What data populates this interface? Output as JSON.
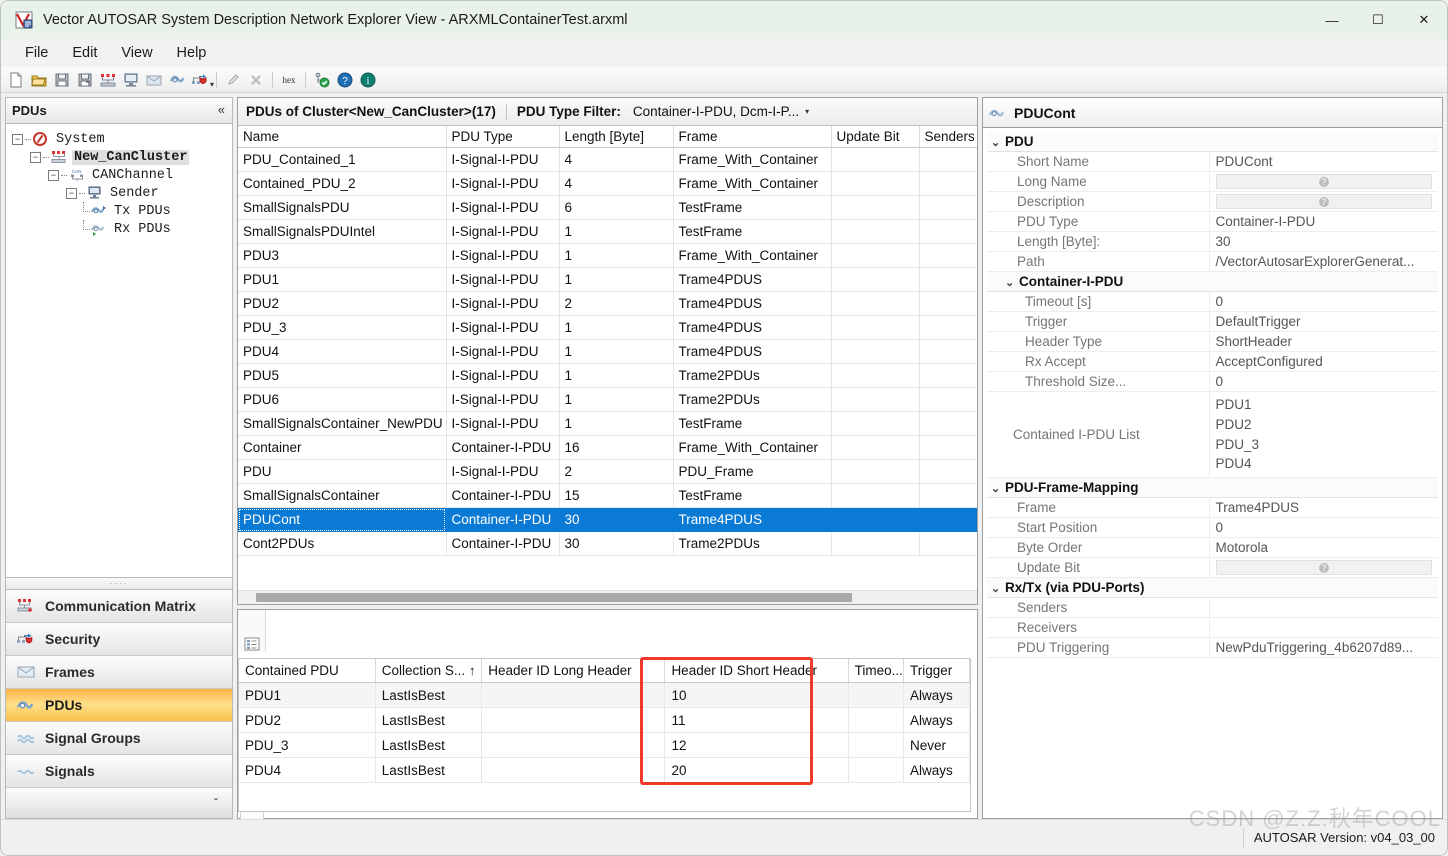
{
  "window": {
    "title": "Vector AUTOSAR System Description Network Explorer View - ARXMLContainerTest.arxml",
    "app_icon": "vector-app-icon",
    "minimize": "—",
    "maximize": "☐",
    "close": "✕"
  },
  "menu": {
    "items": [
      "File",
      "Edit",
      "View",
      "Help"
    ]
  },
  "toolbar": {
    "items": [
      {
        "name": "new-file-icon"
      },
      {
        "name": "open-folder-icon"
      },
      {
        "name": "save-icon"
      },
      {
        "name": "save-as-icon"
      },
      {
        "name": "cluster-icon"
      },
      {
        "name": "ecu-icon"
      },
      {
        "name": "frames-icon"
      },
      {
        "name": "pdus-icon"
      },
      {
        "name": "security-import-icon"
      }
    ],
    "hex_label": "hex",
    "validate_icon": "validate-icon",
    "help_icon": "help-icon",
    "info_icon": "info-icon"
  },
  "explorer": {
    "header": "PDUs",
    "collapse_glyph": "«",
    "tree": [
      {
        "label": "System",
        "icon": "system-icon",
        "depth": 0,
        "expander": "-",
        "selected": false,
        "leaf": false
      },
      {
        "label": "New_CanCluster",
        "icon": "cancluster-icon",
        "depth": 1,
        "expander": "-",
        "selected": true,
        "leaf": false
      },
      {
        "label": "CANChannel",
        "icon": "canchannel-icon",
        "depth": 2,
        "expander": "-",
        "selected": false,
        "leaf": false
      },
      {
        "label": "Sender",
        "icon": "ecu-node-icon",
        "depth": 3,
        "expander": "-",
        "selected": false,
        "leaf": false
      },
      {
        "label": "Tx PDUs",
        "icon": "tx-pdus-icon",
        "depth": 4,
        "expander": "",
        "selected": false,
        "leaf": true
      },
      {
        "label": "Rx PDUs",
        "icon": "rx-pdus-icon",
        "depth": 4,
        "expander": "",
        "selected": false,
        "leaf": true
      }
    ],
    "nav": [
      {
        "label": "Communication Matrix",
        "icon": "comm-matrix-icon",
        "active": false
      },
      {
        "label": "Security",
        "icon": "security-icon",
        "active": false
      },
      {
        "label": "Frames",
        "icon": "frames-envelope-icon",
        "active": false
      },
      {
        "label": "PDUs",
        "icon": "pdus-icon",
        "active": true
      },
      {
        "label": "Signal Groups",
        "icon": "signal-groups-icon",
        "active": false
      },
      {
        "label": "Signals",
        "icon": "signals-icon",
        "active": false
      }
    ],
    "nav_more_glyph": "ˇ"
  },
  "pdu_grid": {
    "title": "PDUs of Cluster<New_CanCluster>(17)",
    "filter_label": "PDU Type Filter:",
    "filter_value": "Container-I-PDU, Dcm-I-P...",
    "filter_caret": "▾",
    "columns": [
      "Name",
      "PDU Type",
      "Length [Byte]",
      "Frame",
      "Update Bit",
      "Senders"
    ],
    "rows": [
      {
        "name": "PDU_Contained_1",
        "type": "I-Signal-I-PDU",
        "length": "4",
        "frame": "Frame_With_Container",
        "update_bit": "",
        "senders": "",
        "selected": false
      },
      {
        "name": "Contained_PDU_2",
        "type": "I-Signal-I-PDU",
        "length": "4",
        "frame": "Frame_With_Container",
        "update_bit": "",
        "senders": "",
        "selected": false
      },
      {
        "name": "SmallSignalsPDU",
        "type": "I-Signal-I-PDU",
        "length": "6",
        "frame": "TestFrame",
        "update_bit": "",
        "senders": "",
        "selected": false
      },
      {
        "name": "SmallSignalsPDUIntel",
        "type": "I-Signal-I-PDU",
        "length": "1",
        "frame": "TestFrame",
        "update_bit": "",
        "senders": "",
        "selected": false
      },
      {
        "name": "PDU3",
        "type": "I-Signal-I-PDU",
        "length": "1",
        "frame": "Frame_With_Container",
        "update_bit": "",
        "senders": "",
        "selected": false
      },
      {
        "name": "PDU1",
        "type": "I-Signal-I-PDU",
        "length": "1",
        "frame": "Trame4PDUS",
        "update_bit": "",
        "senders": "",
        "selected": false
      },
      {
        "name": "PDU2",
        "type": "I-Signal-I-PDU",
        "length": "2",
        "frame": "Trame4PDUS",
        "update_bit": "",
        "senders": "",
        "selected": false
      },
      {
        "name": "PDU_3",
        "type": "I-Signal-I-PDU",
        "length": "1",
        "frame": "Trame4PDUS",
        "update_bit": "",
        "senders": "",
        "selected": false
      },
      {
        "name": "PDU4",
        "type": "I-Signal-I-PDU",
        "length": "1",
        "frame": "Trame4PDUS",
        "update_bit": "",
        "senders": "",
        "selected": false
      },
      {
        "name": "PDU5",
        "type": "I-Signal-I-PDU",
        "length": "1",
        "frame": "Trame2PDUs",
        "update_bit": "",
        "senders": "",
        "selected": false
      },
      {
        "name": "PDU6",
        "type": "I-Signal-I-PDU",
        "length": "1",
        "frame": "Trame2PDUs",
        "update_bit": "",
        "senders": "",
        "selected": false
      },
      {
        "name": "SmallSignalsContainer_NewPDU",
        "type": "I-Signal-I-PDU",
        "length": "1",
        "frame": "TestFrame",
        "update_bit": "",
        "senders": "",
        "selected": false
      },
      {
        "name": "Container",
        "type": "Container-I-PDU",
        "length": "16",
        "frame": "Frame_With_Container",
        "update_bit": "",
        "senders": "",
        "selected": false
      },
      {
        "name": "PDU",
        "type": "I-Signal-I-PDU",
        "length": "2",
        "frame": "PDU_Frame",
        "update_bit": "",
        "senders": "",
        "selected": false
      },
      {
        "name": "SmallSignalsContainer",
        "type": "Container-I-PDU",
        "length": "15",
        "frame": "TestFrame",
        "update_bit": "",
        "senders": "",
        "selected": false
      },
      {
        "name": "PDUCont",
        "type": "Container-I-PDU",
        "length": "30",
        "frame": "Trame4PDUS",
        "update_bit": "",
        "senders": "",
        "selected": true
      },
      {
        "name": "Cont2PDUs",
        "type": "Container-I-PDU",
        "length": "30",
        "frame": "Trame2PDUs",
        "update_bit": "",
        "senders": "",
        "selected": false
      }
    ]
  },
  "contained_grid": {
    "columns": [
      "Contained PDU",
      "Collection S... ↑",
      "Header ID Long Header",
      "Header ID Short Header",
      "Timeo...",
      "Trigger"
    ],
    "rows": [
      {
        "pdu": "PDU1",
        "collection": "LastIsBest",
        "long_header": "",
        "short_header": "10",
        "timeout": "",
        "trigger": "Always"
      },
      {
        "pdu": "PDU2",
        "collection": "LastIsBest",
        "long_header": "",
        "short_header": "11",
        "timeout": "",
        "trigger": "Always"
      },
      {
        "pdu": "PDU_3",
        "collection": "LastIsBest",
        "long_header": "",
        "short_header": "12",
        "timeout": "",
        "trigger": "Never"
      },
      {
        "pdu": "PDU4",
        "collection": "LastIsBest",
        "long_header": "",
        "short_header": "20",
        "timeout": "",
        "trigger": "Always"
      }
    ],
    "highlight_color": "#f0392b",
    "side_icons": [
      "list-view-icon",
      "globe-icon"
    ]
  },
  "properties": {
    "header_title": "PDUCont",
    "header_icon": "pdu-icon",
    "groups": [
      {
        "title": "PDU",
        "expander": "⌄",
        "rows": [
          {
            "label": "Short Name",
            "value": "PDUCont",
            "empty": false
          },
          {
            "label": "Long Name",
            "value": "",
            "empty": true
          },
          {
            "label": "Description",
            "value": "",
            "empty": true
          },
          {
            "label": "PDU Type",
            "value": "Container-I-PDU",
            "empty": false
          },
          {
            "label": "Length [Byte]:",
            "value": "30",
            "empty": false
          },
          {
            "label": "Path",
            "value": "/VectorAutosarExplorerGenerat...",
            "empty": false
          }
        ]
      },
      {
        "title": "Container-I-PDU",
        "expander": "⌄",
        "rows": [
          {
            "label": "Timeout [s]",
            "value": "0",
            "empty": false
          },
          {
            "label": "Trigger",
            "value": "DefaultTrigger",
            "empty": false
          },
          {
            "label": "Header Type",
            "value": "ShortHeader",
            "empty": false
          },
          {
            "label": "Rx Accept",
            "value": "AcceptConfigured",
            "empty": false
          },
          {
            "label": "Threshold Size...",
            "value": "0",
            "empty": false
          },
          {
            "label": "Contained I-PDU List",
            "value": "PDU1\nPDU2\nPDU_3\nPDU4",
            "empty": false,
            "multiline": true
          }
        ]
      },
      {
        "title": "PDU-Frame-Mapping",
        "expander": "⌄",
        "rows": [
          {
            "label": "Frame",
            "value": "Trame4PDUS",
            "empty": false
          },
          {
            "label": "Start Position",
            "value": "0",
            "empty": false
          },
          {
            "label": "Byte Order",
            "value": "Motorola",
            "empty": false
          },
          {
            "label": "Update Bit",
            "value": "",
            "empty": true
          }
        ]
      },
      {
        "title": "Rx/Tx (via PDU-Ports)",
        "expander": "⌄",
        "rows": [
          {
            "label": "Senders",
            "value": "",
            "empty": false
          },
          {
            "label": "Receivers",
            "value": "",
            "empty": false
          },
          {
            "label": "PDU Triggering",
            "value": "NewPduTriggering_4b6207d89...",
            "empty": false
          }
        ]
      }
    ]
  },
  "statusbar": {
    "autosar_version": "AUTOSAR Version: v04_03_00"
  },
  "watermark": {
    "text": "CSDN @Z.Z.秋年COOL"
  },
  "colors": {
    "selection": "#0b7ad5",
    "nav_active": "#fbc24a",
    "highlight_red": "#f0392b",
    "titlebar": "#e8f2e8"
  }
}
